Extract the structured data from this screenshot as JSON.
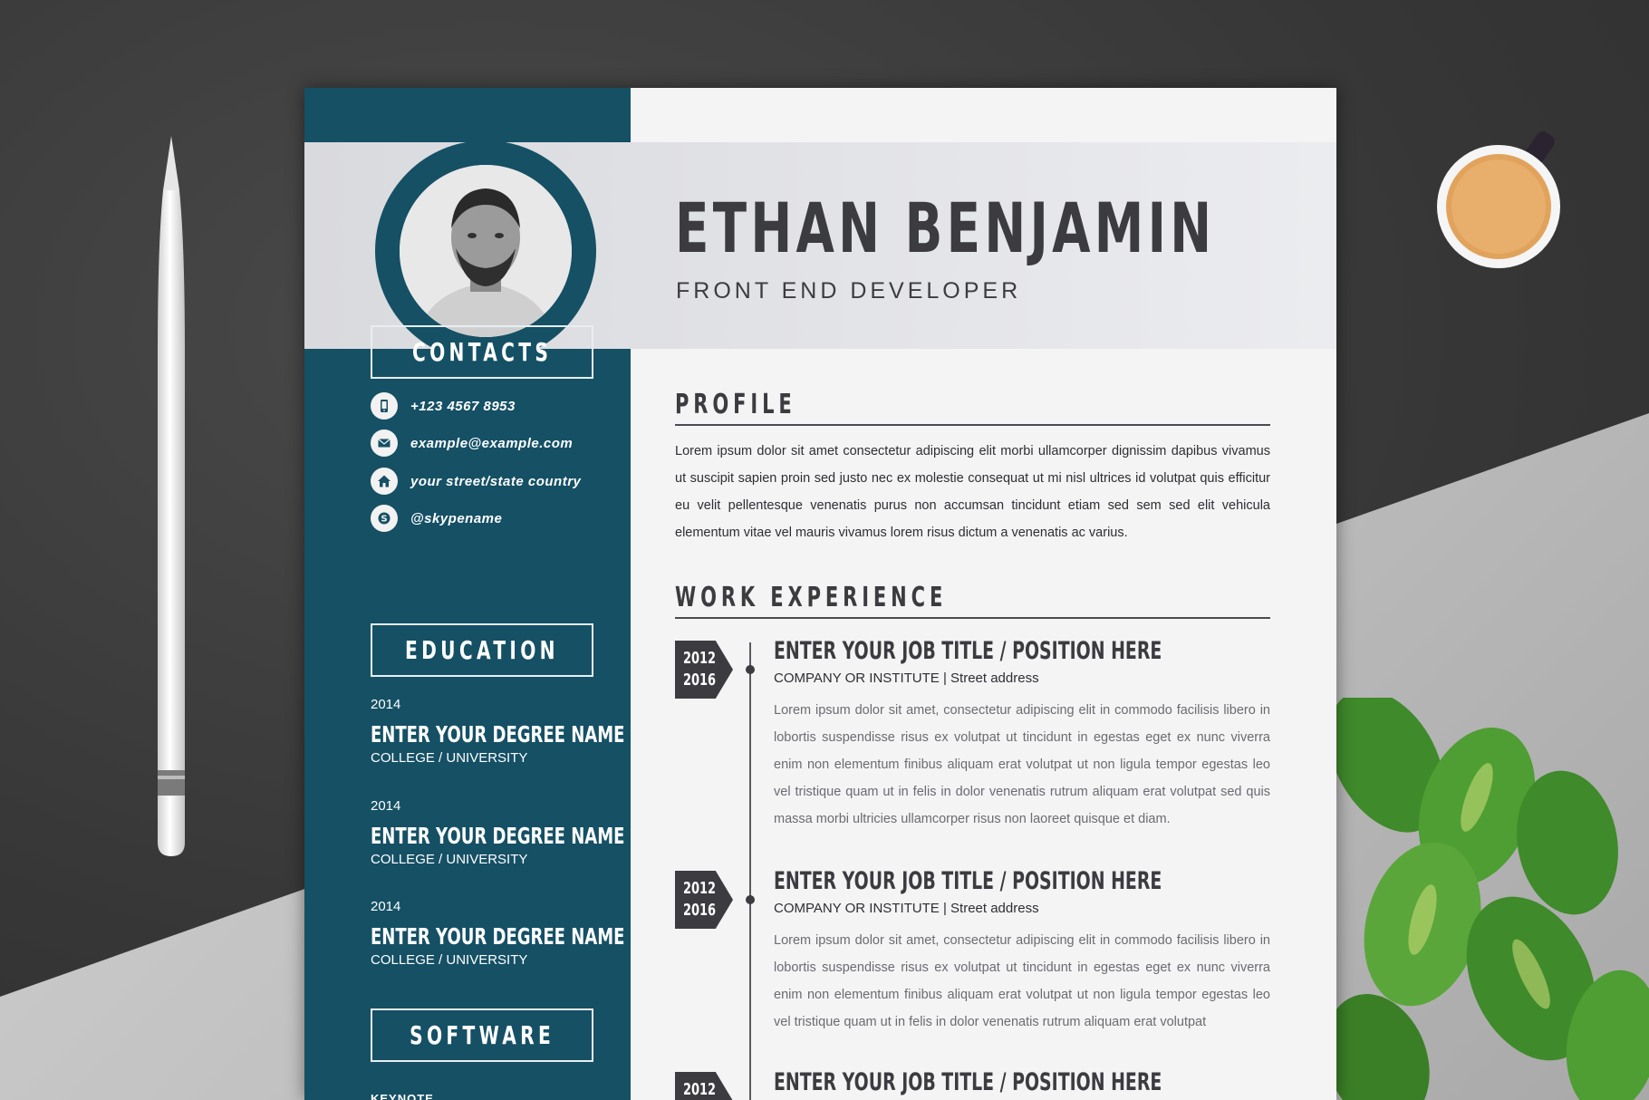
{
  "header": {
    "name": "ETHAN BENJAMIN",
    "role": "FRONT END DEVELOPER"
  },
  "contacts": {
    "title": "CONTACTS",
    "items": [
      {
        "icon": "phone-icon",
        "text": "+123 4567 8953"
      },
      {
        "icon": "mail-icon",
        "text": "example@example.com"
      },
      {
        "icon": "home-icon",
        "text": "your street/state country"
      },
      {
        "icon": "skype-icon",
        "text": "@skypename"
      }
    ]
  },
  "education": {
    "title": "EDUCATION",
    "items": [
      {
        "year": "2014",
        "degree": "ENTER YOUR DEGREE NAME",
        "college": "COLLEGE / UNIVERSITY"
      },
      {
        "year": "2014",
        "degree": "ENTER YOUR DEGREE NAME",
        "college": "COLLEGE / UNIVERSITY"
      },
      {
        "year": "2014",
        "degree": "ENTER YOUR DEGREE NAME",
        "college": "COLLEGE / UNIVERSITY"
      }
    ]
  },
  "software": {
    "title": "SOFTWARE",
    "first_item": "KEYNOTE"
  },
  "profile": {
    "title": "PROFILE",
    "text": "Lorem ipsum dolor sit amet consectetur adipiscing elit morbi ullamcorper dignissim dapibus vivamus ut suscipit sapien proin sed justo nec ex molestie consequat ut mi nisl ultrices id volutpat quis efficitur eu velit pellentesque venenatis purus non accumsan tincidunt etiam sed sem sed elit vehicula elementum vitae vel mauris vivamus lorem risus dictum a venenatis ac varius."
  },
  "work": {
    "title": "WORK EXPERIENCE",
    "jobs": [
      {
        "year_start": "2012",
        "year_end": "2016",
        "title": "ENTER YOUR JOB TITLE / POSITION HERE",
        "company": "COMPANY OR INSTITUTE | Street address",
        "desc": "Lorem ipsum dolor sit amet, consectetur adipiscing elit in commodo facilisis libero in lobortis suspendisse risus ex volutpat ut tincidunt in egestas eget ex nunc viverra enim non elementum finibus aliquam erat volutpat ut non ligula tempor egestas leo vel tristique quam ut in felis in dolor venenatis rutrum aliquam erat volutpat sed quis massa morbi ultricies ullamcorper risus non laoreet quisque et diam."
      },
      {
        "year_start": "2012",
        "year_end": "2016",
        "title": "ENTER YOUR JOB TITLE / POSITION HERE",
        "company": "COMPANY OR INSTITUTE | Street address",
        "desc": "Lorem ipsum dolor sit amet, consectetur adipiscing elit in commodo facilisis libero in lobortis suspendisse risus ex volutpat ut tincidunt in egestas eget ex nunc viverra enim non elementum finibus aliquam erat volutpat ut non ligula tempor egestas leo vel tristique quam ut in felis in dolor venenatis rutrum aliquam erat volutpat"
      },
      {
        "year_start": "2012",
        "title": "ENTER YOUR JOB TITLE / POSITION HERE"
      }
    ]
  },
  "colors": {
    "sidebar": "#155065",
    "text_dark": "#3b3b40",
    "band": "#e3e4e8"
  }
}
